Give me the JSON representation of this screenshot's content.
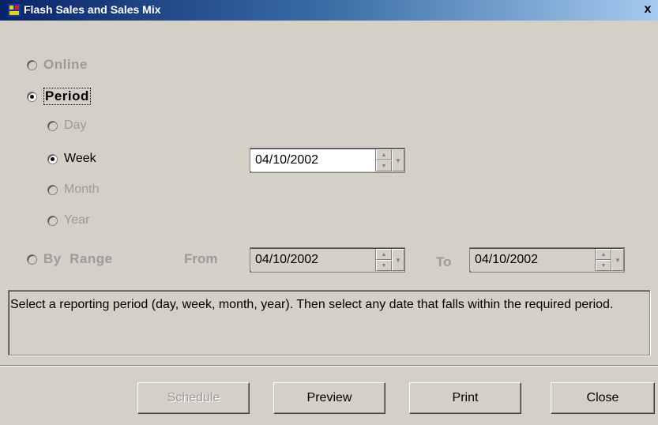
{
  "window": {
    "title": "Flash Sales and Sales Mix",
    "close_glyph": "x"
  },
  "options": {
    "online": "Online",
    "period": "Period",
    "day": "Day",
    "week": "Week",
    "month": "Month",
    "year": "Year",
    "by_range": "By  Range"
  },
  "range": {
    "from_label": "From",
    "to_label": "To"
  },
  "dates": {
    "week_date": "04/10/2002",
    "from_date": "04/10/2002",
    "to_date": "04/10/2002"
  },
  "info_text": "Select a reporting period (day, week, month, year). Then select any date that falls within the required period.",
  "buttons": {
    "schedule": "Schedule",
    "preview": "Preview",
    "print": "Print",
    "close": "Close"
  }
}
